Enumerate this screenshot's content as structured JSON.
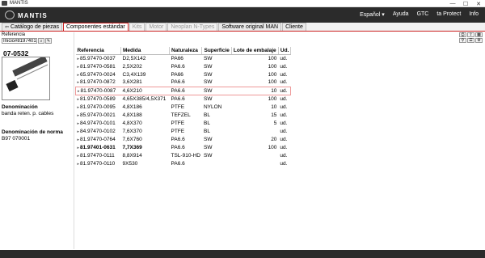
{
  "window": {
    "title": "MANTIS",
    "controls": [
      "—",
      "☐",
      "✕"
    ]
  },
  "header": {
    "brand": "MANTIS",
    "nav": [
      "Español ▾",
      "Ayuda",
      "GTC",
      "ta Protect",
      "Info"
    ]
  },
  "tabs": [
    {
      "label": "Catálogo de piezas",
      "state": "normal",
      "icon": "back-icon"
    },
    {
      "label": "Componentes estándar",
      "state": "active"
    },
    {
      "label": "Kits",
      "state": "disabled"
    },
    {
      "label": "Motor",
      "state": "disabled"
    },
    {
      "label": "Neoplan N-Types",
      "state": "disabled"
    },
    {
      "label": "Software original MAN",
      "state": "normal"
    },
    {
      "label": "Cliente",
      "state": "normal"
    }
  ],
  "left": {
    "ref_label": "Referencia",
    "ref_value": "Inicio#81974010631",
    "part_number": "07-0532",
    "denominacion_label": "Denominación",
    "denominacion_value": "banda reten. p. cables",
    "norma_label": "Denominación de norma",
    "norma_value": "B97 070001"
  },
  "table": {
    "headers": [
      "Referencia",
      "Medida",
      "Naturaleza",
      "Superficie",
      "Lote de embalaje",
      "Ud."
    ],
    "rows": [
      {
        "ref": "85.97470-0037",
        "medida": "D2,5X142",
        "nat": "PA66",
        "sup": "SW",
        "lote": "100",
        "ud": "ud.",
        "bold": false,
        "sel": false
      },
      {
        "ref": "81.97470-0581",
        "medida": "2,5X202",
        "nat": "PA6.6",
        "sup": "SW",
        "lote": "100",
        "ud": "ud.",
        "bold": false,
        "sel": false
      },
      {
        "ref": "65.97470-0024",
        "medida": "C3,4X139",
        "nat": "PA66",
        "sup": "SW",
        "lote": "100",
        "ud": "ud.",
        "bold": false,
        "sel": false
      },
      {
        "ref": "81.97470-0872",
        "medida": "3,6X281",
        "nat": "PA6.6",
        "sup": "SW",
        "lote": "100",
        "ud": "ud.",
        "bold": false,
        "sel": false
      },
      {
        "ref": "81.97470-0087",
        "medida": "4,6X210",
        "nat": "PA6.6",
        "sup": "SW",
        "lote": "10",
        "ud": "ud.",
        "bold": false,
        "sel": true
      },
      {
        "ref": "81.97470-0589",
        "medida": "4,65X385/4,5X371",
        "nat": "PA6.6",
        "sup": "SW",
        "lote": "100",
        "ud": "ud.",
        "bold": false,
        "sel": false
      },
      {
        "ref": "81.97470-0095",
        "medida": "4,8X186",
        "nat": "PTFE",
        "sup": "NYLON",
        "lote": "10",
        "ud": "ud.",
        "bold": false,
        "sel": false
      },
      {
        "ref": "85.97470-0021",
        "medida": "4,8X188",
        "nat": "TEFZEL",
        "sup": "BL",
        "lote": "15",
        "ud": "ud.",
        "bold": false,
        "sel": false
      },
      {
        "ref": "84.97470-0101",
        "medida": "4,8X370",
        "nat": "PTFE",
        "sup": "BL",
        "lote": "5",
        "ud": "ud.",
        "bold": false,
        "sel": false
      },
      {
        "ref": "84.97470-0102",
        "medida": "7,6X370",
        "nat": "PTFE",
        "sup": "BL",
        "lote": "",
        "ud": "ud.",
        "bold": false,
        "sel": false
      },
      {
        "ref": "81.97470-0764",
        "medida": "7,6X760",
        "nat": "PA6.6",
        "sup": "SW",
        "lote": "20",
        "ud": "ud.",
        "bold": false,
        "sel": false
      },
      {
        "ref": "81.97401-0631",
        "medida": "7,7X369",
        "nat": "PA6.6",
        "sup": "SW",
        "lote": "100",
        "ud": "ud.",
        "bold": true,
        "sel": false
      },
      {
        "ref": "81.97470-0111",
        "medida": "8,8X914",
        "nat": "TSL-910-HD",
        "sup": "SW",
        "lote": "",
        "ud": "ud.",
        "bold": false,
        "sel": false
      },
      {
        "ref": "81.97470-0110",
        "medida": "9X530",
        "nat": "PA6.6",
        "sup": "",
        "lote": "",
        "ud": "ud.",
        "bold": false,
        "sel": false
      }
    ]
  },
  "colors": {
    "header_bg": "#2b2b2b",
    "accent": "#cc2222",
    "selection_border": "#ee9999"
  }
}
